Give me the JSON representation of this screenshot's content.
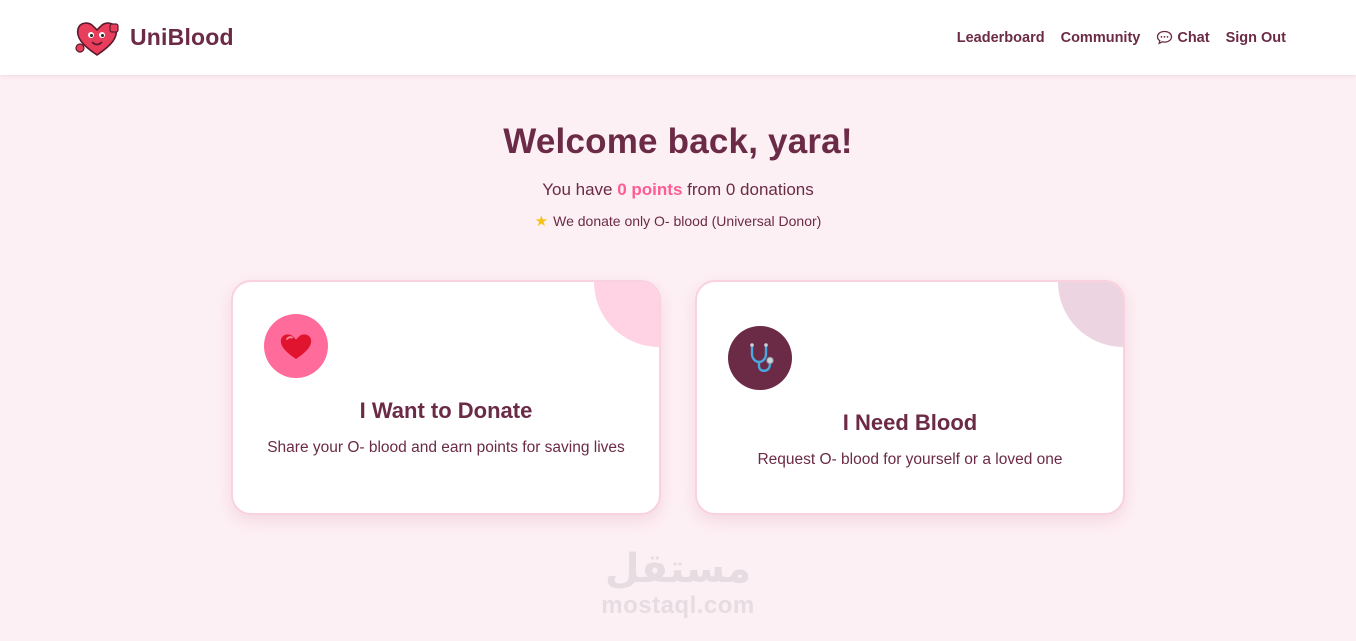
{
  "brand": {
    "name": "UniBlood",
    "logo_icon": "heart-mascot-icon"
  },
  "nav": {
    "leaderboard": "Leaderboard",
    "community": "Community",
    "chat": "Chat",
    "chat_icon": "speech-bubble-icon",
    "sign_out": "Sign Out"
  },
  "hero": {
    "title": "Welcome back, yara!",
    "sub_prefix": "You have ",
    "points": "0 points",
    "sub_suffix": " from 0 donations",
    "note": "We donate only O- blood (Universal Donor)",
    "note_icon": "star-icon"
  },
  "cards": {
    "donate": {
      "icon": "heart-icon",
      "title": "I Want to Donate",
      "description": "Share your O- blood and earn points for saving lives"
    },
    "need": {
      "icon": "stethoscope-icon",
      "title": "I Need Blood",
      "description": "Request O- blood for yourself or a loved one"
    }
  },
  "watermark": {
    "arabic": "مستقل",
    "latin": "mostaql.com"
  },
  "colors": {
    "primary": "#6b2a45",
    "accent": "#ff5c94",
    "donate_icon_bg": "#ff6b9b",
    "background": "#fdf0f4"
  }
}
